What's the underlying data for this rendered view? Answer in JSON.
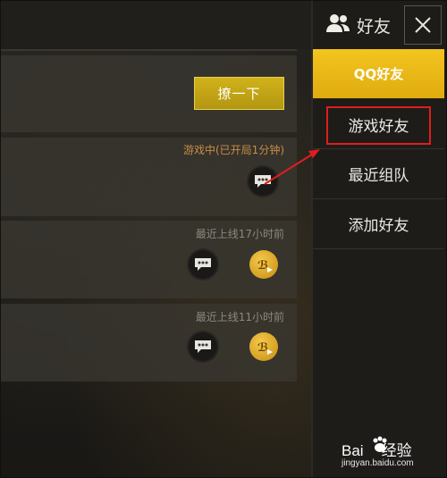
{
  "friends_panel": {
    "title": "好友",
    "tabs": [
      {
        "label": "QQ好友",
        "active": true
      },
      {
        "label": "游戏好友",
        "active": false,
        "highlighted": true
      },
      {
        "label": "最近组队",
        "active": false
      },
      {
        "label": "添加好友",
        "active": false
      }
    ]
  },
  "friend_list": {
    "rows": [
      {
        "action_label": "撩一下"
      },
      {
        "status": "游戏中(已开局1分钟)",
        "status_color": "#c88d44"
      },
      {
        "status": "最近上线17小时前",
        "status_color": "#8c8880"
      },
      {
        "status": "最近上线11小时前",
        "status_color": "#8c8880"
      }
    ]
  },
  "watermark": {
    "brand": "Bai",
    "brand_suffix": "经验",
    "url": "jingyan.baidu.com"
  },
  "colors": {
    "accent": "#f3c51e",
    "highlight": "#e01d1d"
  }
}
